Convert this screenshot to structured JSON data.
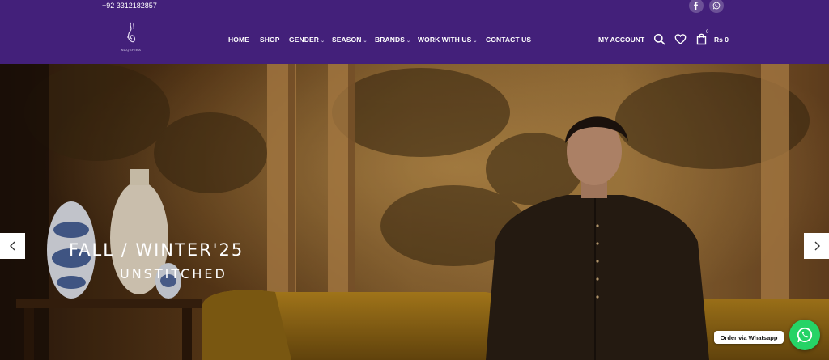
{
  "topbar": {
    "phone": "+92 3312182857",
    "social": [
      {
        "icon": "facebook-icon"
      },
      {
        "icon": "whatsapp-icon"
      }
    ]
  },
  "header": {
    "logo_text": "NAQSHIBA",
    "nav": [
      {
        "label": "HOME",
        "has_dropdown": false
      },
      {
        "label": "SHOP",
        "has_dropdown": false
      },
      {
        "label": "GENDER",
        "has_dropdown": true
      },
      {
        "label": "SEASON",
        "has_dropdown": true
      },
      {
        "label": "BRANDS",
        "has_dropdown": true
      },
      {
        "label": "WORK WITH US",
        "has_dropdown": true
      },
      {
        "label": "CONTACT US",
        "has_dropdown": false
      }
    ],
    "account_label": "MY ACCOUNT",
    "cart_count": "0",
    "cart_total": "Rs 0"
  },
  "hero": {
    "title": "FALL / WINTER'25",
    "subtitle": "UNSTITCHED"
  },
  "whatsapp": {
    "order_label": "Order via Whatsapp"
  },
  "colors": {
    "header_bg": "#43207a",
    "whatsapp_green": "#25d366"
  }
}
